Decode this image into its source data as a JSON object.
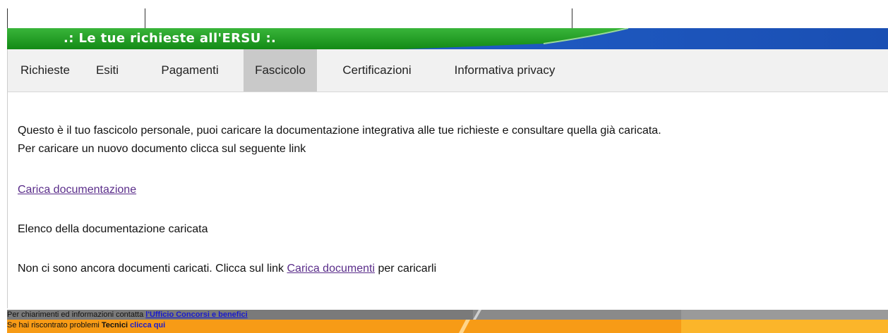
{
  "banner": {
    "title": ".: Le tue richieste all'ERSU :."
  },
  "tabs": [
    {
      "label": "Richieste"
    },
    {
      "label": "Esiti"
    },
    {
      "label": "Pagamenti"
    },
    {
      "label": "Fascicolo",
      "active": true
    },
    {
      "label": "Certificazioni"
    },
    {
      "label": "Informativa privacy"
    }
  ],
  "content": {
    "intro_line1": "Questo è il tuo fascicolo personale, puoi caricare la documentazione integrativa alle tue richieste e consultare quella già caricata.",
    "intro_line2": "Per caricare un nuovo documento clicca sul seguente link",
    "upload_link": "Carica documentazione",
    "list_heading": "Elenco della documentazione caricata",
    "empty_before": "Non ci sono ancora documenti caricati. Clicca sul link ",
    "empty_link": "Carica documenti",
    "empty_after": " per caricarli"
  },
  "footer": {
    "line1_text": "Per chiarimenti ed informazioni contatta ",
    "line1_link": "l'Ufficio Concorsi e benefici",
    "line2_text": "Se hai riscontrato problemi ",
    "line2_bold": "Tecnici",
    "line2_link": "clicca qui"
  },
  "colors": {
    "banner_green": "#1f9a1f",
    "banner_blue": "#1a5bc8",
    "tab_active": "#c9c9c9",
    "link_visited": "#5a2d8a",
    "footer_gray": "#777777",
    "footer_orange": "#f5a418"
  }
}
